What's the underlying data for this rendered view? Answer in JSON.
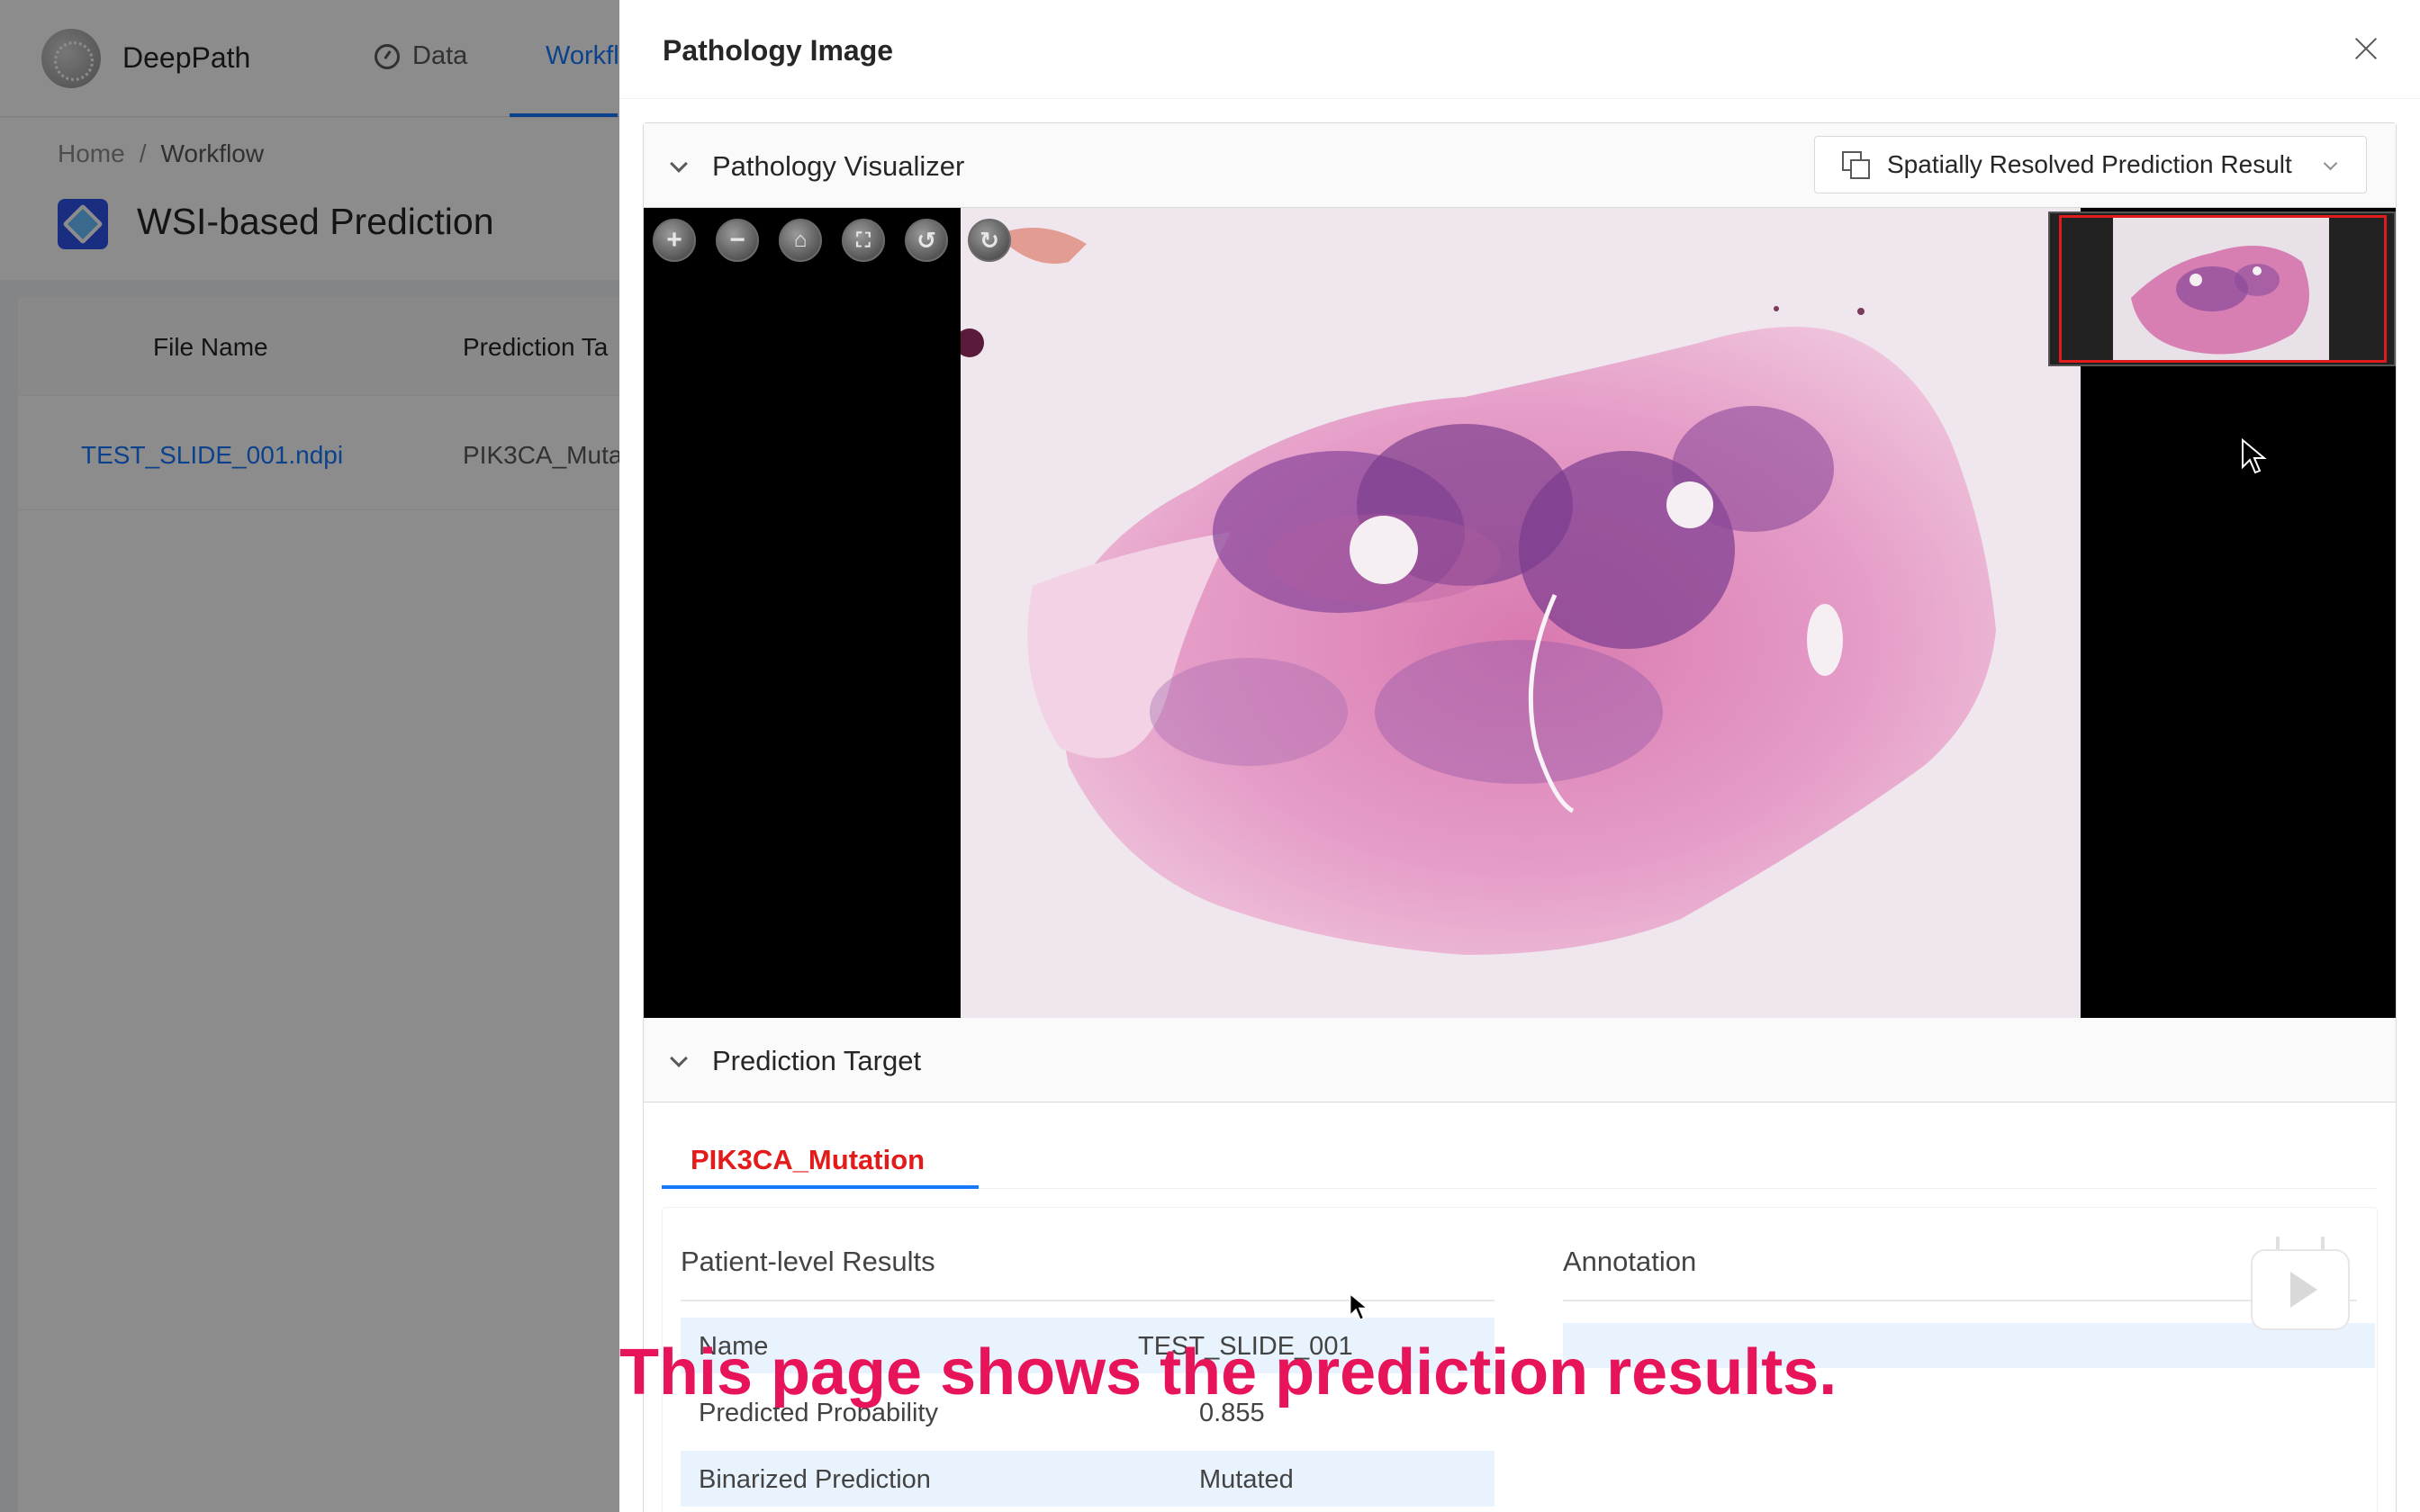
{
  "app": {
    "name": "DeepPath"
  },
  "nav": {
    "data_label": "Data",
    "workflow_label": "Workfl"
  },
  "breadcrumb": {
    "home": "Home",
    "separator": "/",
    "current": "Workflow"
  },
  "page": {
    "title": "WSI-based Prediction"
  },
  "table": {
    "columns": [
      "File Name",
      "Prediction Ta"
    ],
    "rows": [
      {
        "file_name": "TEST_SLIDE_001.ndpi",
        "prediction_target": "PIK3CA_Muta"
      }
    ]
  },
  "drawer": {
    "title": "Pathology Image",
    "visualizer": {
      "title": "Pathology Visualizer",
      "select_value": "Spatially Resolved Prediction Result",
      "toolbar_icons": [
        "zoom-in-icon",
        "zoom-out-icon",
        "home-icon",
        "fullscreen-icon",
        "rotate-left-icon",
        "rotate-right-icon"
      ]
    },
    "prediction_target": {
      "title": "Prediction Target",
      "active_tab": "PIK3CA_Mutation",
      "patient_results": {
        "title": "Patient-level Results",
        "rows": [
          {
            "key": "Name",
            "value": "TEST_SLIDE_001"
          },
          {
            "key": "Predicted Probability",
            "value": "0.855"
          },
          {
            "key": "Binarized Prediction",
            "value": "Mutated"
          }
        ]
      },
      "annotation": {
        "title": "Annotation"
      }
    }
  },
  "caption": "This page shows the prediction results.",
  "colors": {
    "accent": "#1677ff",
    "tab_active_text": "#e31b1b",
    "caption": "#e8145a",
    "row_highlight": "#e8f3fd",
    "nav_box": "#e01b1b"
  }
}
